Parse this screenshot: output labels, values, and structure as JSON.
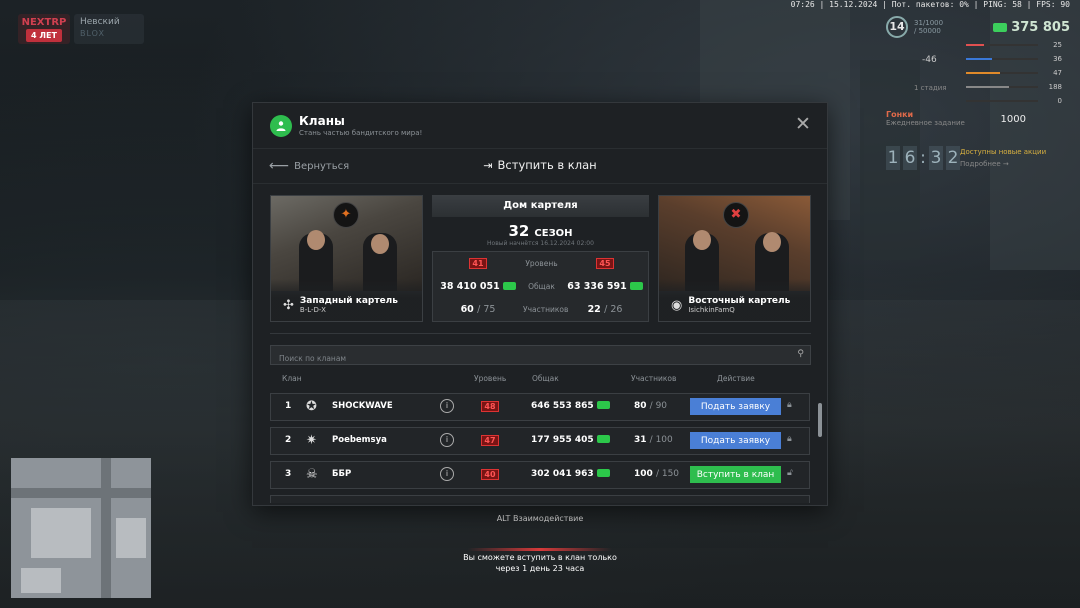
{
  "hud": {
    "status_line": "07:26 | 15.12.2024 | Пот. пакетов: 0% | PING: 58 | FPS: 90",
    "brand": "NEXTRP",
    "brand_sub": "4 ЛЕТ",
    "server_name": "Невский",
    "server_sub": "BLOX",
    "level": "14",
    "xp": "31/1000 / 50000",
    "money": "375 805",
    "bars": [
      {
        "value": "25",
        "color": "#e05050",
        "fill": 0.25
      },
      {
        "value": "36",
        "color": "#3a78d8",
        "fill": 0.36
      },
      {
        "value": "47",
        "color": "#e08a2a",
        "fill": 0.47
      },
      {
        "value": "188",
        "color": "#888888",
        "fill": 0.6
      },
      {
        "value": "0",
        "color": "#cccccc",
        "fill": 0.0
      }
    ],
    "temp": "-46",
    "stage": "1 стадия",
    "race_title": "Гонки",
    "race_sub": "Ежедневное задание",
    "race_amount": "1000",
    "clock_h1": "1",
    "clock_h2": "6",
    "clock_m1": "3",
    "clock_m2": "2",
    "available": "Доступны новые акции",
    "available_more": "Подробнее →",
    "alt_hint": "ALT Взаимодействие",
    "cooldown_line1": "Вы сможете вступить в клан только",
    "cooldown_line2": "через 1 день 23 часа"
  },
  "modal": {
    "title": "Кланы",
    "subtitle": "Стань частью бандитского мира!",
    "back_label": "Вернуться",
    "center_title": "Вступить в клан",
    "home_title": "Дом картеля",
    "season_num": "32",
    "season_word": "СЕЗОН",
    "season_sub": "Новый начнётся 16.12.2024 02:00",
    "west": {
      "name": "Западный картель",
      "tag": "B-L-D-X",
      "level": "41",
      "total": "38 410 051",
      "members": "60",
      "members_max": "75"
    },
    "east": {
      "name": "Восточный картель",
      "tag": "IsichkinFamQ",
      "level": "45",
      "total": "63 336 591",
      "members": "22",
      "members_max": "26"
    },
    "stat_labels": {
      "level": "Уровень",
      "total": "Общак",
      "members": "Участников"
    },
    "search_placeholder": "Поиск по кланам",
    "columns": {
      "clan": "Клан",
      "level": "Уровень",
      "total": "Общак",
      "members": "Участников",
      "action": "Действие"
    },
    "rows": [
      {
        "rank": "1",
        "name": "SHOCKWAVE",
        "level": "48",
        "total": "646 553 865",
        "members": "80",
        "members_max": "90",
        "action": "Подать заявку",
        "action_type": "apply"
      },
      {
        "rank": "2",
        "name": "Poebemsya",
        "level": "47",
        "total": "177 955 405",
        "members": "31",
        "members_max": "100",
        "action": "Подать заявку",
        "action_type": "apply"
      },
      {
        "rank": "3",
        "name": "ББР",
        "level": "40",
        "total": "302 041 963",
        "members": "100",
        "members_max": "150",
        "action": "Вступить в клан",
        "action_type": "join"
      }
    ]
  },
  "colors": {
    "accent_green": "#2ebd4e",
    "accent_blue": "#4a7fd6",
    "level_red": "#d33333"
  },
  "icons": {
    "modal": "users-icon",
    "close": "close-icon",
    "back": "arrow-left-icon",
    "enter": "door-enter-icon",
    "search": "search-icon",
    "info": "info-icon",
    "lock": "lock-icon",
    "unlock": "unlock-icon",
    "cash": "cash-icon"
  }
}
